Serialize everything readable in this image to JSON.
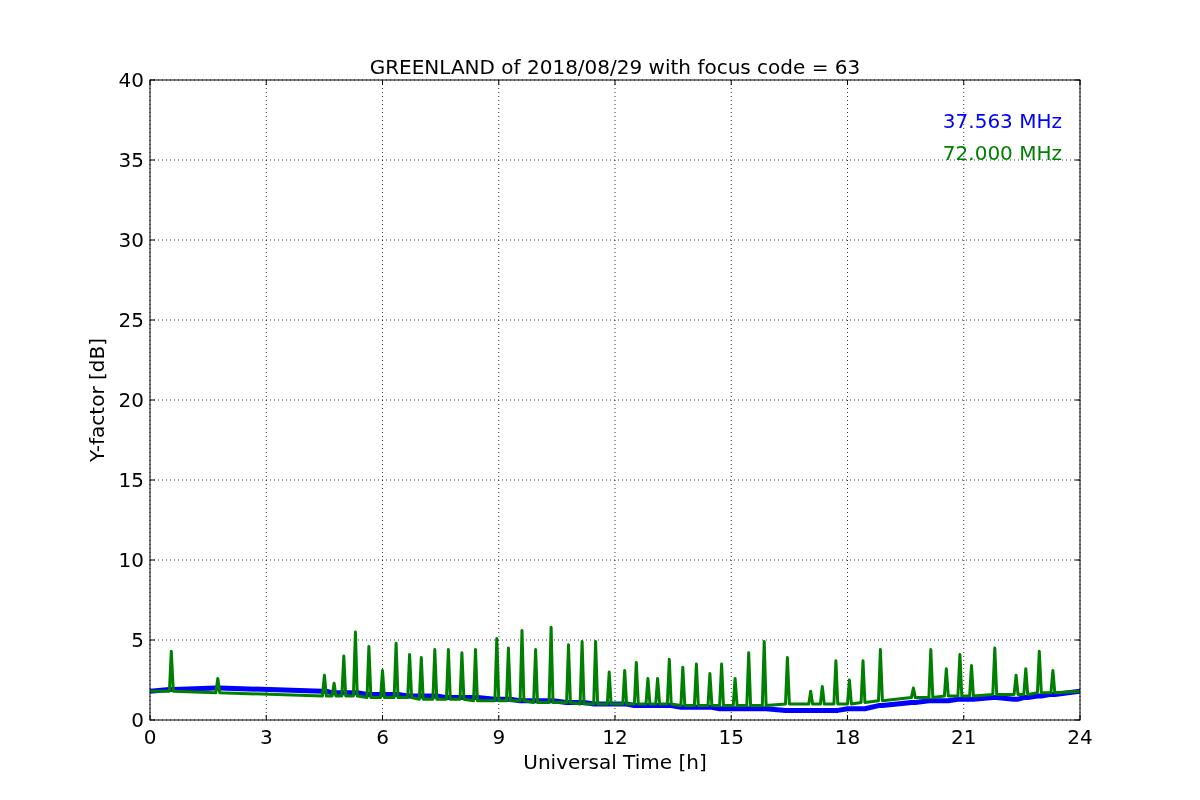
{
  "chart_data": {
    "type": "line",
    "title": "GREENLAND of 2018/08/29 with focus code = 63",
    "xlabel": "Universal Time [h]",
    "ylabel": "Y-factor [dB]",
    "grid": true,
    "xlim": [
      0,
      24
    ],
    "ylim": [
      0,
      40
    ],
    "xticks": [
      0,
      3,
      6,
      9,
      12,
      15,
      18,
      21,
      24
    ],
    "yticks": [
      0,
      5,
      10,
      15,
      20,
      25,
      30,
      35,
      40
    ],
    "x": [
      0,
      0.5,
      0.55,
      0.6,
      1.7,
      1.75,
      1.8,
      4.45,
      4.5,
      4.55,
      4.7,
      4.75,
      4.8,
      4.95,
      5,
      5.05,
      5.25,
      5.3,
      5.35,
      5.6,
      5.65,
      5.7,
      5.95,
      6,
      6.05,
      6.3,
      6.35,
      6.4,
      6.65,
      6.7,
      6.75,
      6.95,
      7,
      7.05,
      7.3,
      7.35,
      7.4,
      7.65,
      7.7,
      7.75,
      8,
      8.05,
      8.1,
      8.35,
      8.4,
      8.45,
      8.9,
      8.95,
      9,
      9.2,
      9.25,
      9.3,
      9.55,
      9.6,
      9.65,
      9.9,
      9.95,
      10,
      10.3,
      10.35,
      10.4,
      10.75,
      10.8,
      10.85,
      11.1,
      11.15,
      11.2,
      11.45,
      11.5,
      11.55,
      11.8,
      11.85,
      11.9,
      12.2,
      12.25,
      12.3,
      12.5,
      12.55,
      12.6,
      12.8,
      12.85,
      12.9,
      13.05,
      13.1,
      13.15,
      13.35,
      13.4,
      13.45,
      13.7,
      13.75,
      13.8,
      14.05,
      14.1,
      14.15,
      14.4,
      14.45,
      14.5,
      14.7,
      14.75,
      14.8,
      15.05,
      15.1,
      15.15,
      15.4,
      15.45,
      15.5,
      15.8,
      15.85,
      15.9,
      16.4,
      16.45,
      16.5,
      17,
      17.05,
      17.1,
      17.3,
      17.35,
      17.4,
      17.65,
      17.7,
      17.75,
      18,
      18.05,
      18.1,
      18.35,
      18.4,
      18.45,
      18.8,
      18.85,
      18.9,
      19.65,
      19.7,
      19.75,
      20.1,
      20.15,
      20.2,
      20.5,
      20.55,
      20.6,
      20.85,
      20.9,
      20.95,
      21.15,
      21.2,
      21.25,
      21.75,
      21.8,
      21.85,
      22.3,
      22.35,
      22.4,
      22.55,
      22.6,
      22.65,
      22.9,
      22.95,
      23,
      23.25,
      23.3,
      23.35,
      24
    ],
    "series": [
      {
        "name": "37.563 MHz",
        "color": "#0000ff",
        "values": [
          1.8,
          1.9,
          1.9,
          1.9,
          2.0,
          2.0,
          2.0,
          1.8,
          1.8,
          1.8,
          1.7,
          1.7,
          1.7,
          1.7,
          1.7,
          1.7,
          1.7,
          1.7,
          1.7,
          1.6,
          1.6,
          1.6,
          1.6,
          1.6,
          1.6,
          1.6,
          1.6,
          1.6,
          1.5,
          1.5,
          1.5,
          1.5,
          1.5,
          1.5,
          1.5,
          1.5,
          1.5,
          1.4,
          1.4,
          1.4,
          1.4,
          1.4,
          1.4,
          1.4,
          1.4,
          1.4,
          1.3,
          1.3,
          1.3,
          1.3,
          1.3,
          1.3,
          1.2,
          1.2,
          1.2,
          1.2,
          1.2,
          1.2,
          1.2,
          1.2,
          1.2,
          1.1,
          1.1,
          1.1,
          1.1,
          1.1,
          1.1,
          1.0,
          1.0,
          1.0,
          1.0,
          1.0,
          1.0,
          1.0,
          1.0,
          1.0,
          0.9,
          0.9,
          0.9,
          0.9,
          0.9,
          0.9,
          0.9,
          0.9,
          0.9,
          0.9,
          0.9,
          0.9,
          0.8,
          0.8,
          0.8,
          0.8,
          0.8,
          0.8,
          0.8,
          0.8,
          0.8,
          0.7,
          0.7,
          0.7,
          0.7,
          0.7,
          0.7,
          0.7,
          0.7,
          0.7,
          0.7,
          0.7,
          0.7,
          0.6,
          0.6,
          0.6,
          0.6,
          0.6,
          0.6,
          0.6,
          0.6,
          0.6,
          0.6,
          0.6,
          0.6,
          0.7,
          0.7,
          0.7,
          0.7,
          0.7,
          0.7,
          0.9,
          0.9,
          0.9,
          1.1,
          1.1,
          1.1,
          1.2,
          1.2,
          1.2,
          1.2,
          1.2,
          1.2,
          1.3,
          1.3,
          1.3,
          1.3,
          1.3,
          1.3,
          1.4,
          1.4,
          1.4,
          1.3,
          1.3,
          1.3,
          1.4,
          1.4,
          1.4,
          1.5,
          1.5,
          1.5,
          1.6,
          1.6,
          1.6,
          1.8
        ]
      },
      {
        "name": "72.000 MHz",
        "color": "#008000",
        "values": [
          1.8,
          1.8,
          4.3,
          1.8,
          1.7,
          2.6,
          1.7,
          1.5,
          2.8,
          1.5,
          1.5,
          2.3,
          1.5,
          1.5,
          4.0,
          1.5,
          1.5,
          5.5,
          1.5,
          1.4,
          4.6,
          1.4,
          1.4,
          3.1,
          1.4,
          1.4,
          4.8,
          1.4,
          1.4,
          4.1,
          1.4,
          1.3,
          3.9,
          1.3,
          1.3,
          4.4,
          1.3,
          1.3,
          4.4,
          1.3,
          1.3,
          4.2,
          1.3,
          1.2,
          4.4,
          1.2,
          1.2,
          5.1,
          1.2,
          1.2,
          4.5,
          1.2,
          1.2,
          5.6,
          1.2,
          1.1,
          4.4,
          1.1,
          1.1,
          5.8,
          1.1,
          1.1,
          4.7,
          1.1,
          1.0,
          4.9,
          1.0,
          1.0,
          4.9,
          1.0,
          1.0,
          3.0,
          1.0,
          1.0,
          3.1,
          1.0,
          1.0,
          3.6,
          1.0,
          1.0,
          2.6,
          1.0,
          1.0,
          2.6,
          1.0,
          1.0,
          3.8,
          1.0,
          0.9,
          3.3,
          0.9,
          0.9,
          3.5,
          0.9,
          0.9,
          2.9,
          0.9,
          0.9,
          3.5,
          0.9,
          0.9,
          2.6,
          0.9,
          0.9,
          4.2,
          0.9,
          0.9,
          4.9,
          0.9,
          1.0,
          3.9,
          1.0,
          1.0,
          1.8,
          1.0,
          1.0,
          2.1,
          1.0,
          1.0,
          3.7,
          1.0,
          1.0,
          2.5,
          1.0,
          1.1,
          3.7,
          1.1,
          1.2,
          4.4,
          1.2,
          1.4,
          2.0,
          1.4,
          1.4,
          4.4,
          1.4,
          1.5,
          3.2,
          1.5,
          1.5,
          4.1,
          1.5,
          1.5,
          3.4,
          1.5,
          1.6,
          4.5,
          1.6,
          1.6,
          2.8,
          1.6,
          1.6,
          3.2,
          1.6,
          1.7,
          4.3,
          1.7,
          1.7,
          3.1,
          1.7,
          1.8
        ]
      }
    ]
  }
}
